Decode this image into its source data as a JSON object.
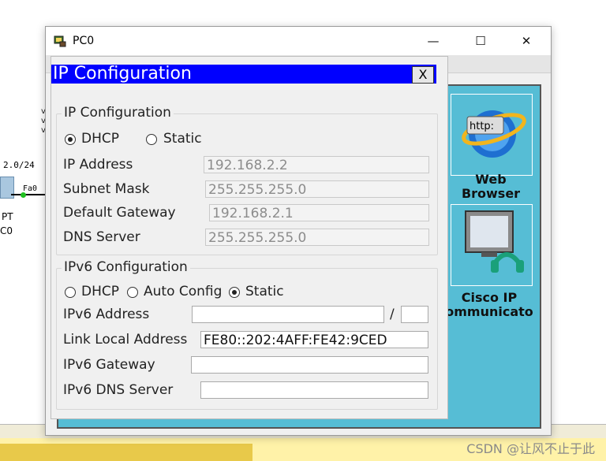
{
  "window": {
    "title": "PC0",
    "minimize": "—",
    "maximize": "☐",
    "close": "✕"
  },
  "background": {
    "network_label": "2.0/24",
    "port_label": "Fa0",
    "device_type": "PT",
    "device_name": "C0",
    "watermark": "CSDN @让风不止于此"
  },
  "desktop_apps": [
    {
      "name": "Web Browser",
      "line1": "Web",
      "line2": "Browser",
      "icon_text": "http:"
    },
    {
      "name": "Cisco IP Communicator",
      "line1": "Cisco IP",
      "line2": "ommunicato"
    }
  ],
  "ip_config": {
    "title": "IP Configuration",
    "close_label": "X",
    "ipv4": {
      "group_title": "IP Configuration",
      "mode_dhcp": "DHCP",
      "mode_static": "Static",
      "selected_mode": "DHCP",
      "ip_address_label": "IP Address",
      "ip_address": "192.168.2.2",
      "subnet_mask_label": "Subnet Mask",
      "subnet_mask": "255.255.255.0",
      "default_gateway_label": "Default Gateway",
      "default_gateway": "192.168.2.1",
      "dns_server_label": "DNS Server",
      "dns_server": "255.255.255.0"
    },
    "ipv6": {
      "group_title": "IPv6 Configuration",
      "mode_dhcp": "DHCP",
      "mode_auto": "Auto Config",
      "mode_static": "Static",
      "selected_mode": "Static",
      "address_label": "IPv6 Address",
      "address": "",
      "prefix_separator": "/",
      "prefix": "",
      "link_local_label": "Link Local Address",
      "link_local": "FE80::202:4AFF:FE42:9CED",
      "gateway_label": "IPv6 Gateway",
      "gateway": "",
      "dns_label": "IPv6 DNS Server",
      "dns": ""
    }
  }
}
